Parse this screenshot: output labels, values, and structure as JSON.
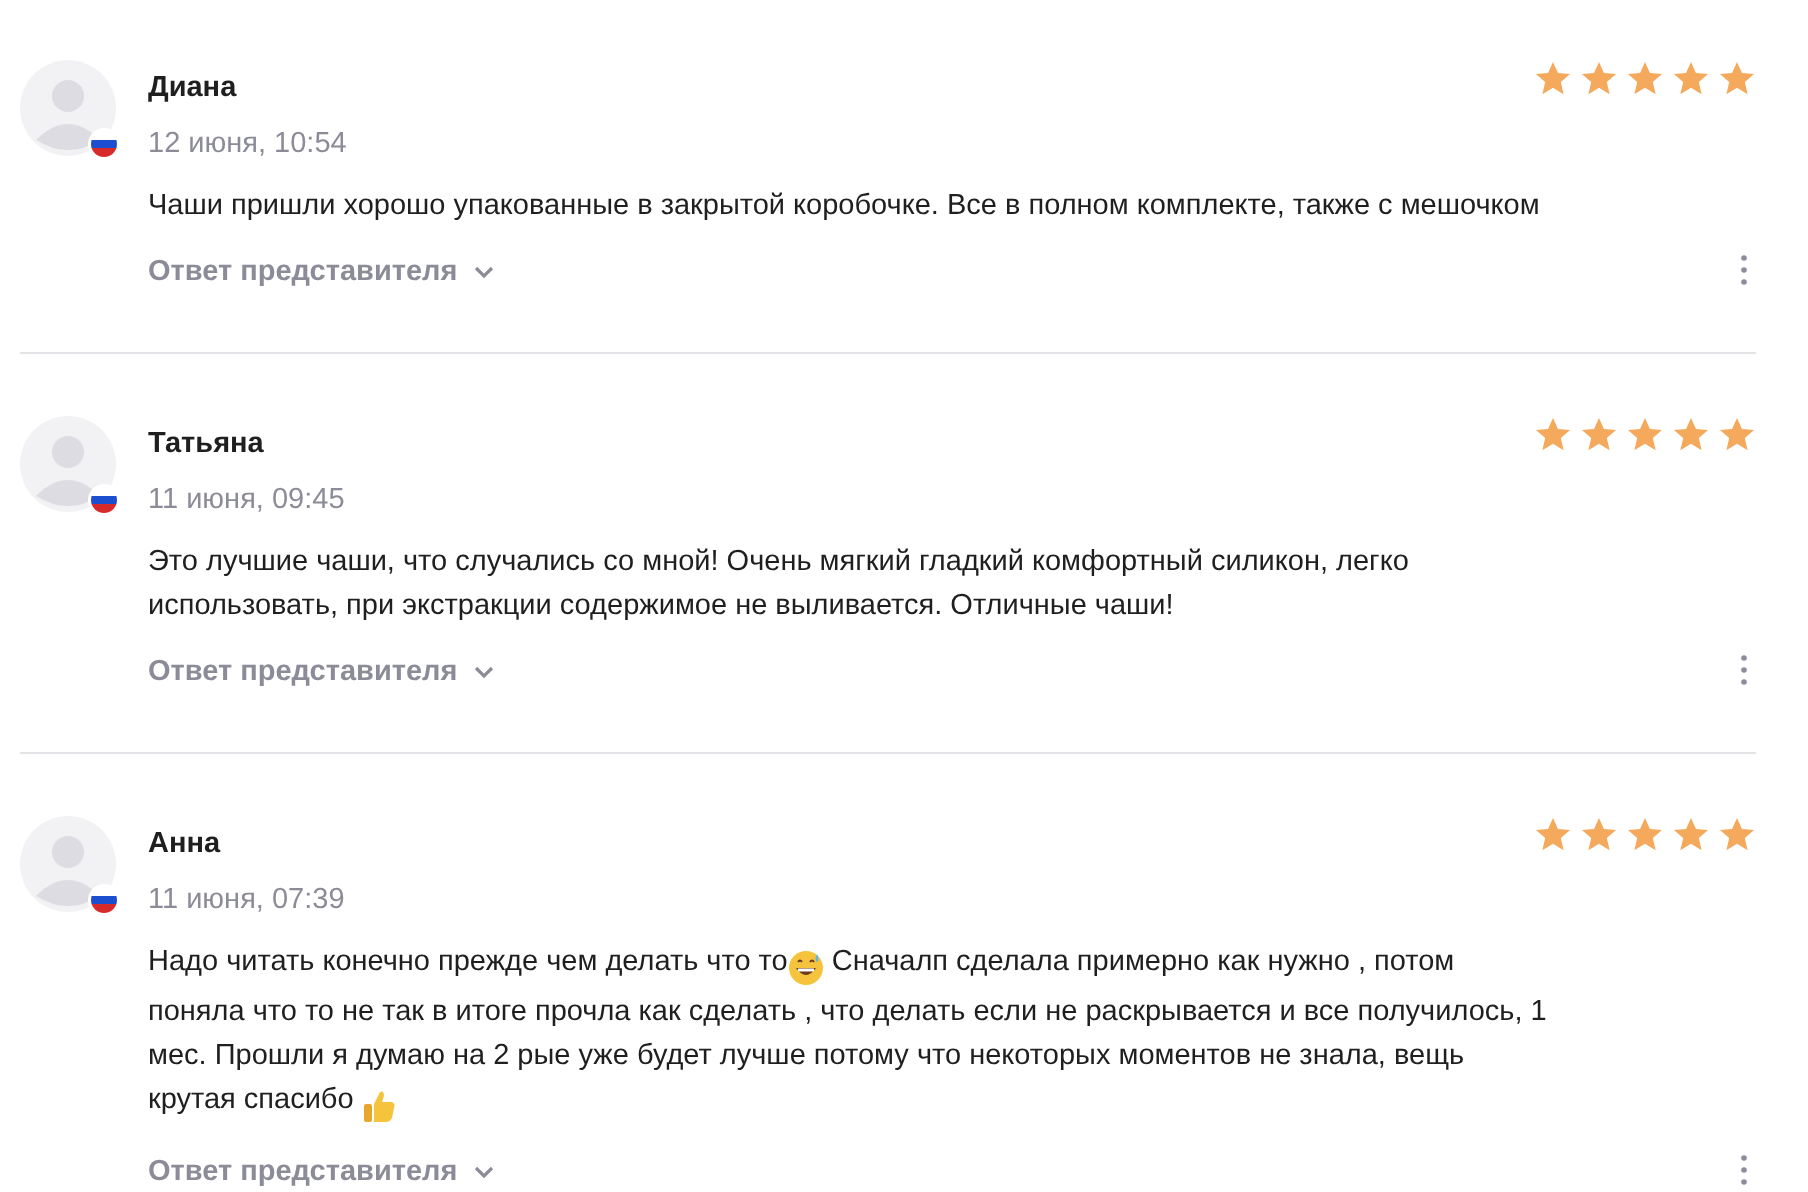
{
  "reviews": [
    {
      "author": "Диана",
      "date": "12 июня, 10:54",
      "stars": 5,
      "text": [
        {
          "kind": "text",
          "text": "Чаши пришли хорошо упакованные в закрытой коробочке. Все в полном комплекте, также с мешочком"
        }
      ],
      "reply_toggle": "Ответ представителя"
    },
    {
      "author": "Татьяна",
      "date": "11 июня, 09:45",
      "stars": 5,
      "text": [
        {
          "kind": "text",
          "text": "Это лучшие чаши, что случались со мной! Очень мягкий гладкий комфортный силикон, легко использовать, при экстракции содержимое не выливается. Отличные чаши!"
        }
      ],
      "reply_toggle": "Ответ представителя"
    },
    {
      "author": "Анна",
      "date": "11 июня, 07:39",
      "stars": 5,
      "text": [
        {
          "kind": "text",
          "text": "Надо читать конечно прежде чем делать что то"
        },
        {
          "kind": "sweat-smile"
        },
        {
          "kind": "text",
          "text": " Сначалп сделала примерно как нужно , потом поняла что то не так в итоге прочла как сделать , что делать если не раскрывается и все получилось, 1 мес. Прошли я думаю на 2 рые уже будет лучше потому что некоторых моментов не знала, вещь крутая спасибо "
        },
        {
          "kind": "thumbs-up"
        }
      ],
      "reply_toggle": "Ответ представителя"
    }
  ]
}
